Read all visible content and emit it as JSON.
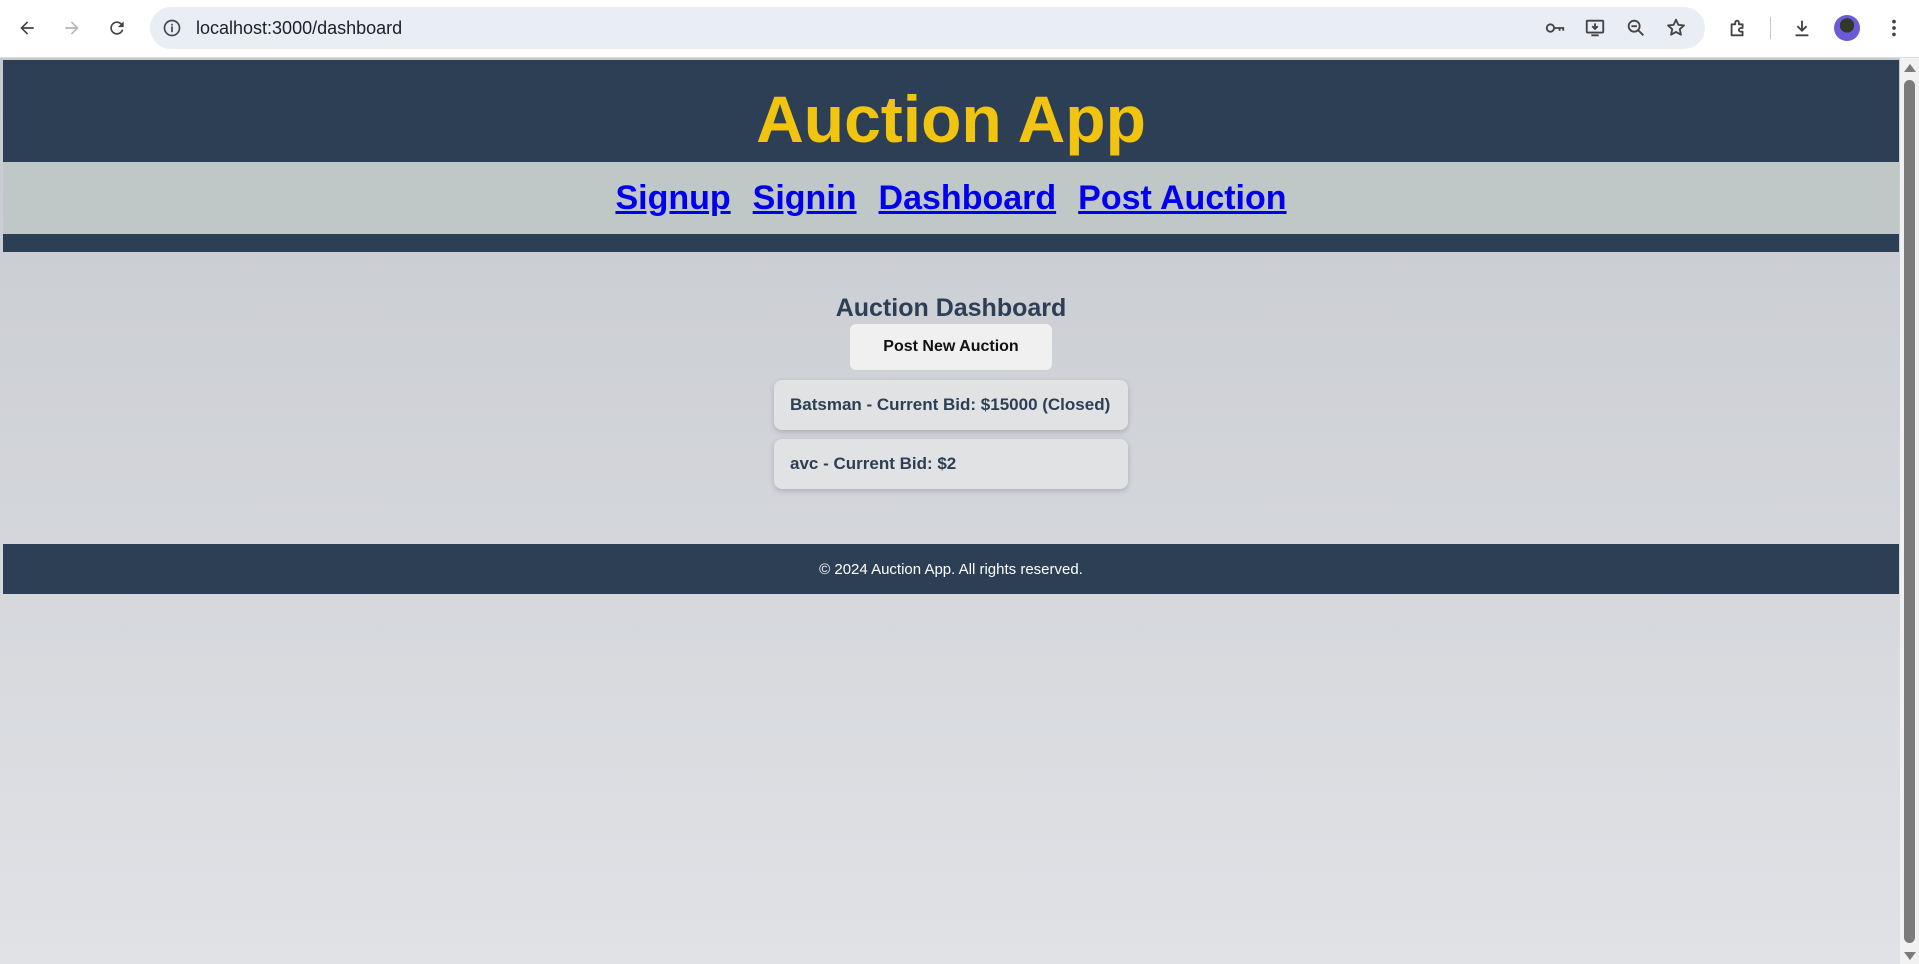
{
  "browser": {
    "url": "localhost:3000/dashboard"
  },
  "site": {
    "title": "Auction App"
  },
  "nav": {
    "links": [
      "Signup",
      "Signin",
      "Dashboard",
      "Post Auction"
    ]
  },
  "dashboard": {
    "heading": "Auction Dashboard",
    "post_button": "Post New Auction",
    "auctions": [
      "Batsman - Current Bid: $15000 (Closed)",
      "avc - Current Bid: $2"
    ]
  },
  "footer": {
    "text": "© 2024 Auction App. All rights reserved."
  },
  "colors": {
    "header_bg": "#2d3f54",
    "title": "#f1c40f",
    "nav_bg": "#bfc7c7",
    "link": "#0000ee"
  }
}
